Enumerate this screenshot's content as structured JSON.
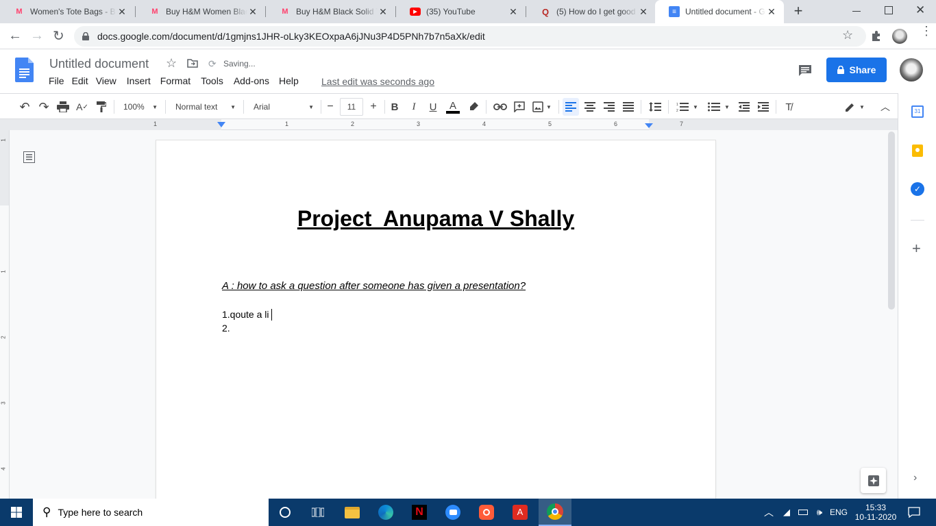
{
  "browser": {
    "tabs": [
      {
        "title": "Women's Tote Bags - B",
        "favicon": "M",
        "favicon_color": "#ff3f6c"
      },
      {
        "title": "Buy H&M Women Black",
        "favicon": "M",
        "favicon_color": "#ff3f6c"
      },
      {
        "title": "Buy H&M Black Solid To",
        "favicon": "M",
        "favicon_color": "#ff3f6c"
      },
      {
        "title": "(35) YouTube",
        "favicon": "▶",
        "favicon_color": "#ff0000"
      },
      {
        "title": "(5) How do I get good a",
        "favicon": "Q",
        "favicon_color": "#b92b27"
      },
      {
        "title": "Untitled document - Go",
        "favicon": "≡",
        "favicon_color": "#4285f4"
      }
    ],
    "new_tab": "+",
    "url": "docs.google.com/document/d/1gmjns1JHR-oLky3KEOxpaA6jJNu3P4D5PNh7b7n5aXk/edit"
  },
  "docs": {
    "title": "Untitled document",
    "status": "Saving...",
    "menu": [
      "File",
      "Edit",
      "View",
      "Insert",
      "Format",
      "Tools",
      "Add-ons",
      "Help"
    ],
    "last_edit": "Last edit was seconds ago",
    "share_label": "Share",
    "accent": "#1a73e8"
  },
  "toolbar": {
    "zoom": "100%",
    "style": "Normal text",
    "font": "Arial",
    "font_size": "11",
    "bold": "B",
    "italic": "I",
    "underline": "U",
    "text_color": "A"
  },
  "ruler": {
    "marks": [
      "1",
      "1",
      "2",
      "3",
      "4",
      "5",
      "6",
      "7"
    ],
    "vmarks": [
      "1",
      "1",
      "2",
      "3",
      "4"
    ]
  },
  "document": {
    "heading": "Project  Anupama V Shally",
    "question": "A : how to ask a question after someone has given a presentation?",
    "line1": "1.qoute a li",
    "line2": "2."
  },
  "taskbar": {
    "search_placeholder": "Type here to search",
    "lang": "ENG",
    "time": "15:33",
    "date": "10-11-2020"
  }
}
